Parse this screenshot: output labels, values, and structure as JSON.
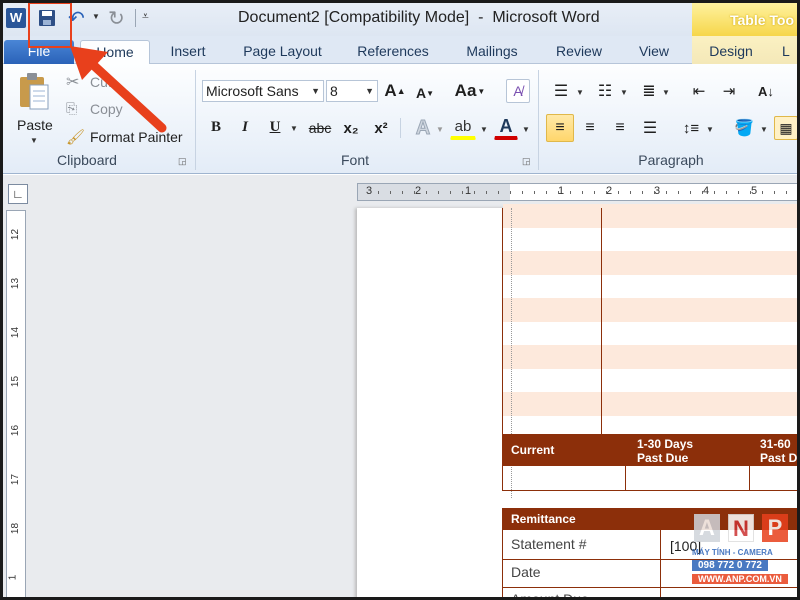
{
  "titlebar": {
    "title": "Document2 [Compatibility Mode]  -  Microsoft Word",
    "context_tab": "Table Too"
  },
  "tabs": [
    "File",
    "Home",
    "Insert",
    "Page Layout",
    "References",
    "Mailings",
    "Review",
    "View",
    "Design",
    "L"
  ],
  "clipboard": {
    "paste": "Paste",
    "cut": "Cut",
    "copy": "Copy",
    "format_painter": "Format Painter",
    "label": "Clipboard"
  },
  "font": {
    "name": "Microsoft Sans",
    "size": "8",
    "label": "Font",
    "bold": "B",
    "italic": "I",
    "underline": "U",
    "strike": "abc",
    "sub": "x₂",
    "sup": "x²",
    "grow": "A",
    "shrink": "A",
    "case": "Aa"
  },
  "paragraph": {
    "label": "Paragraph"
  },
  "ruler": {
    "h_ticks": [
      "3",
      "2",
      "1",
      "1",
      "2",
      "3",
      "4",
      "5"
    ],
    "v_ticks": [
      "12",
      "13",
      "14",
      "15",
      "16",
      "17",
      "18",
      "1"
    ]
  },
  "table": {
    "aging_headers": [
      "Current",
      "1-30 Days\nPast Due",
      "31-60\nPast D"
    ],
    "remittance_header": "Remittance",
    "remit_rows": [
      {
        "label": "Statement #",
        "value": "[100]"
      },
      {
        "label": "Date",
        "value": ""
      },
      {
        "label": "Amount Due",
        "value": ""
      }
    ]
  },
  "watermark": {
    "letters": [
      "A",
      "N",
      "P"
    ],
    "line1": "MÁY TÍNH - CAMERA",
    "phone": "098 772 0 772",
    "url": "WWW.ANP.COM.VN"
  },
  "colors": {
    "accent": "#2a62b8",
    "table_header": "#8c2f0a",
    "stripe": "#fde9dc",
    "annotation": "#e8401c"
  }
}
